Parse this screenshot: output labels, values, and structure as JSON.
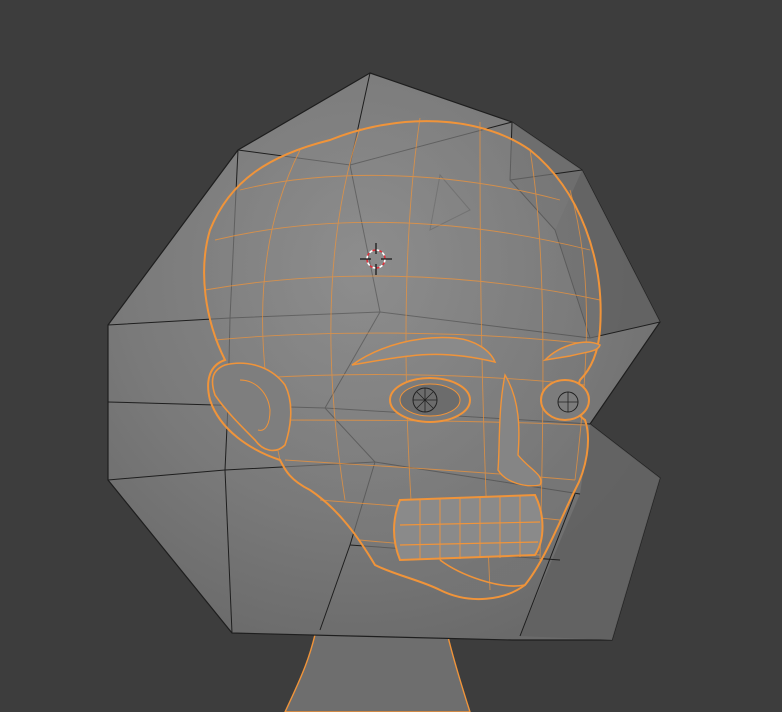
{
  "viewport": {
    "mode": "3D Viewport",
    "background_color": "#3d3d3d"
  },
  "objects": [
    {
      "name": "cage-mesh",
      "kind": "low-poly cage",
      "fill_color": "#7b7b7b",
      "edge_color": "#1e1e1e"
    },
    {
      "name": "head-mesh",
      "kind": "selected wireframe",
      "wire_color": "#f0943a"
    }
  ],
  "cursor": {
    "icon": "3d-cursor-icon",
    "ring_color": "#ffffff",
    "dash_color": "#e0303a"
  },
  "colors": {
    "selection": "#f0943a",
    "cage_fill": "#7b7b7b",
    "edge": "#1e1e1e"
  }
}
